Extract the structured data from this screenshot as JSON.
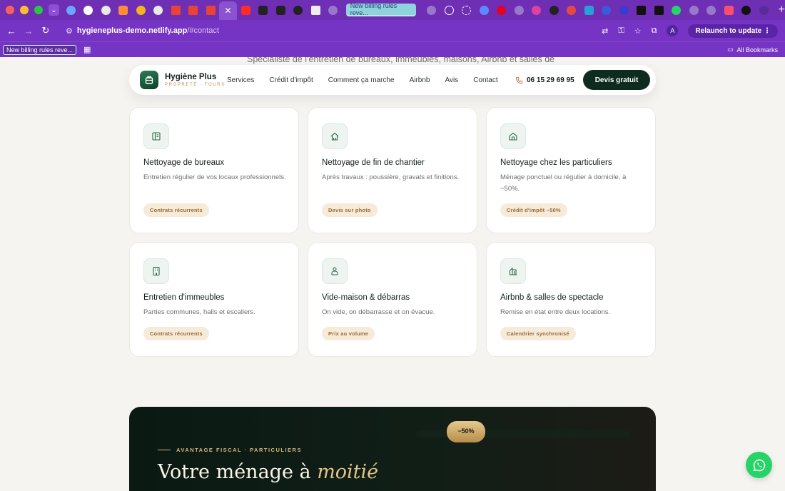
{
  "browser": {
    "active_tab_title": "New billing rules reve...",
    "url_host": "hygieneplus-demo.netlify.app",
    "url_path": "/#contact",
    "relaunch_label": "Relaunch to update",
    "avatar_initial": "A",
    "bookmark_chip": "New billing rules reve...",
    "all_bookmarks": "All Bookmarks"
  },
  "hero_fragment": "Spécialiste de l'entretien de bureaux, immeubles, maisons, Airbnb et salles de",
  "header": {
    "brand_name": "Hygiène Plus",
    "brand_tagline": "PROPRETÉ · TOURS",
    "nav": [
      "Services",
      "Crédit d'impôt",
      "Comment ça marche",
      "Airbnb",
      "Avis",
      "Contact"
    ],
    "phone": "06 15 29 69 95",
    "cta": "Devis gratuit"
  },
  "services": [
    {
      "title": "Nettoyage de bureaux",
      "desc": "Entretien régulier de vos locaux professionnels.",
      "tag": "Contrats récurrents",
      "icon": "office-icon"
    },
    {
      "title": "Nettoyage de fin de chantier",
      "desc": "Après travaux : poussière, gravats et finitions.",
      "tag": "Devis sur photo",
      "icon": "construction-icon"
    },
    {
      "title": "Nettoyage chez les particuliers",
      "desc": "Ménage ponctuel ou régulier à domicile, à −50%.",
      "tag": "Crédit d'impôt −50%",
      "icon": "home-icon"
    },
    {
      "title": "Entretien d'immeubles",
      "desc": "Parties communes, halls et escaliers.",
      "tag": "Contrats récurrents",
      "icon": "building-icon"
    },
    {
      "title": "Vide-maison & débarras",
      "desc": "On vide, on débarrasse et on évacue.",
      "tag": "Prix au volume",
      "icon": "person-icon"
    },
    {
      "title": "Airbnb & salles de spectacle",
      "desc": "Remise en état entre deux locations.",
      "tag": "Calendrier synchronisé",
      "icon": "venue-icon"
    }
  ],
  "promo": {
    "eyebrow": "AVANTAGE FISCAL · PARTICULIERS",
    "title_start": "Votre ménage à ",
    "title_em": "moitié",
    "badge": "−50%"
  },
  "colors": {
    "browser_purple": "#7634c4",
    "brand_dark_green": "#0d2b1e",
    "tag_bg": "#f6ead9",
    "tag_text": "#9a6a35",
    "gold": "#d7b77c",
    "whatsapp": "#25d366"
  }
}
